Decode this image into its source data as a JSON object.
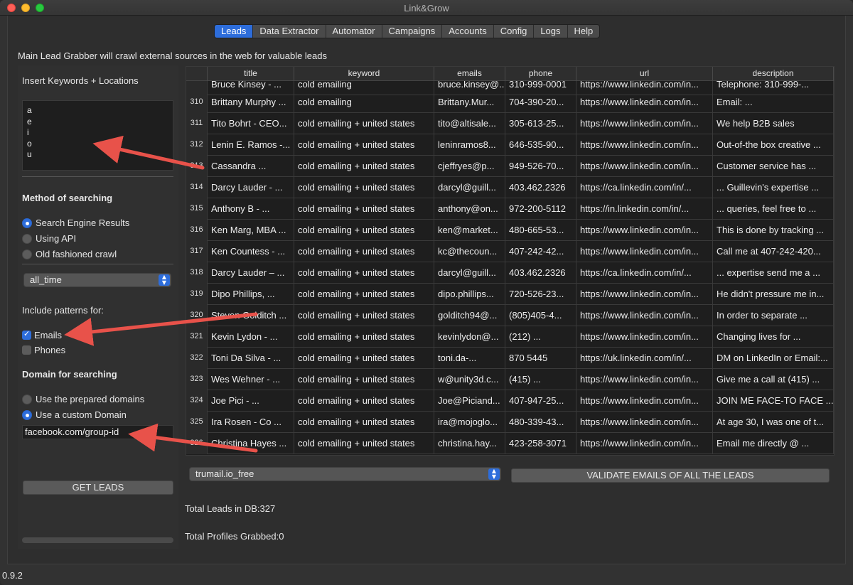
{
  "app": {
    "title": "Link&Grow",
    "version": "0.9.2"
  },
  "tabs": [
    "Leads",
    "Data Extractor",
    "Automator",
    "Campaigns",
    "Accounts",
    "Config",
    "Logs",
    "Help"
  ],
  "intro_text": "Main Lead Grabber will crawl external sources in the web for valuable leads",
  "sidebar": {
    "keywords_label": "Insert Keywords + Locations",
    "keywords": [
      "a",
      "e",
      "i",
      "o",
      "u"
    ],
    "method_label": "Method of searching",
    "methods": [
      "Search Engine Results",
      "Using API",
      "Old fashioned crawl"
    ],
    "method_selected": 0,
    "time_select": "all_time",
    "patterns_label": "Include patterns for:",
    "patterns": [
      {
        "label": "Emails",
        "checked": true
      },
      {
        "label": "Phones",
        "checked": false
      }
    ],
    "domain_label": "Domain for searching",
    "domain_options": [
      "Use the prepared domains",
      "Use a custom Domain"
    ],
    "domain_selected": 1,
    "domain_value": "facebook.com/group-id",
    "get_leads_button": "GET LEADS"
  },
  "table": {
    "columns": [
      "title",
      "keyword",
      "emails",
      "phone",
      "url",
      "description"
    ],
    "partial_row": [
      "Bruce Kinsey - ...",
      "cold emailing",
      "bruce.kinsey@...",
      "310-999-0001",
      "https://www.linkedin.com/in...",
      "Telephone: 310-999-..."
    ],
    "rows": [
      [
        "310",
        "Brittany Murphy ...",
        "cold emailing",
        "Brittany.Mur...",
        "704-390-20...",
        "https://www.linkedin.com/in...",
        "Email: ..."
      ],
      [
        "311",
        "Tito Bohrt - CEO...",
        "cold emailing + united states",
        "tito@altisale...",
        "305-613-25...",
        "https://www.linkedin.com/in...",
        "We help B2B sales"
      ],
      [
        "312",
        "Lenin E. Ramos -...",
        "cold emailing + united states",
        "leninramos8...",
        "646-535-90...",
        "https://www.linkedin.com/in...",
        "Out-of-the box creative ..."
      ],
      [
        "313",
        "Cassandra ...",
        "cold emailing + united states",
        "cjeffryes@p...",
        "949-526-70...",
        "https://www.linkedin.com/in...",
        "Customer service has ..."
      ],
      [
        "314",
        "Darcy Lauder - ...",
        "cold emailing + united states",
        "darcyl@guill...",
        "403.462.2326",
        "https://ca.linkedin.com/in/...",
        "... Guillevin's expertise ..."
      ],
      [
        "315",
        "Anthony B - ...",
        "cold emailing + united states",
        "anthony@on...",
        "972-200-5112",
        "https://in.linkedin.com/in/...",
        "... queries, feel free to ..."
      ],
      [
        "316",
        "Ken Marg, MBA ...",
        "cold emailing + united states",
        "ken@market...",
        "480-665-53...",
        "https://www.linkedin.com/in...",
        "This is done by tracking ..."
      ],
      [
        "317",
        "Ken Countess - ...",
        "cold emailing + united states",
        "kc@thecoun...",
        "407-242-42...",
        "https://www.linkedin.com/in...",
        "Call me at 407-242-420..."
      ],
      [
        "318",
        "Darcy Lauder – ...",
        "cold emailing + united states",
        "darcyl@guill...",
        "403.462.2326",
        "https://ca.linkedin.com/in/...",
        "... expertise send me a ..."
      ],
      [
        "319",
        "Dipo Phillips, ...",
        "cold emailing + united states",
        "dipo.phillips...",
        "720-526-23...",
        "https://www.linkedin.com/in...",
        "He didn't pressure me in..."
      ],
      [
        "320",
        "Steven Golditch ...",
        "cold emailing + united states",
        "golditch94@...",
        "(805)405-4...",
        "https://www.linkedin.com/in...",
        "In order to separate ..."
      ],
      [
        "321",
        "Kevin Lydon - ...",
        "cold emailing + united states",
        "kevinlydon@...",
        "(212) ...",
        "https://www.linkedin.com/in...",
        "Changing lives for ..."
      ],
      [
        "322",
        "Toni Da Silva - ...",
        "cold emailing + united states",
        "toni.da-...",
        "870 5445",
        "https://uk.linkedin.com/in/...",
        "DM on LinkedIn or Email:..."
      ],
      [
        "323",
        "Wes Wehner - ...",
        "cold emailing + united states",
        "w@unity3d.c...",
        "(415) ...",
        "https://www.linkedin.com/in...",
        "Give me a call at (415) ..."
      ],
      [
        "324",
        "Joe Pici - ...",
        "cold emailing + united states",
        "Joe@Piciand...",
        "407-947-25...",
        "https://www.linkedin.com/in...",
        "JOIN ME FACE-TO FACE ..."
      ],
      [
        "325",
        "Ira Rosen - Co ...",
        "cold emailing + united states",
        "ira@mojoglo...",
        "480-339-43...",
        "https://www.linkedin.com/in...",
        "At age 30, I was one of t..."
      ],
      [
        "326",
        "Christina Hayes ...",
        "cold emailing + united states",
        "christina.hay...",
        "423-258-3071",
        "https://www.linkedin.com/in...",
        "Email me directly @ ..."
      ]
    ]
  },
  "validator_select": "trumail.io_free",
  "validate_button": "VALIDATE EMAILS OF ALL THE LEADS",
  "stats": {
    "total_leads": "Total Leads in DB:327",
    "total_profiles": "Total Profiles Grabbed:0"
  },
  "colors": {
    "accent": "#2d6ddb",
    "arrow": "#e8524a"
  }
}
